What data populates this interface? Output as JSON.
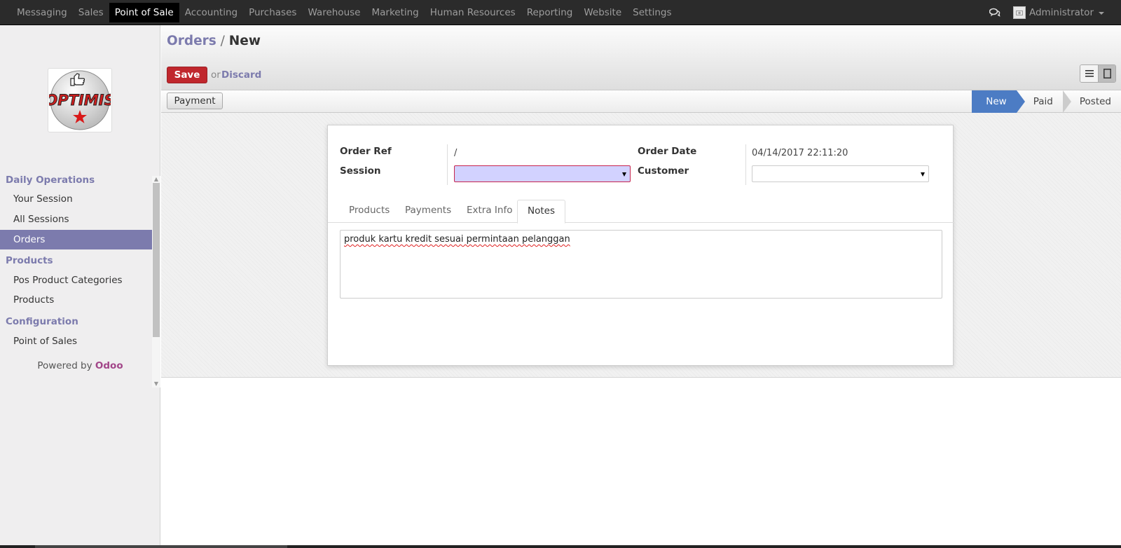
{
  "topbar": {
    "menu": [
      {
        "label": "Messaging",
        "active": false
      },
      {
        "label": "Sales",
        "active": false
      },
      {
        "label": "Point of Sale",
        "active": true
      },
      {
        "label": "Accounting",
        "active": false
      },
      {
        "label": "Purchases",
        "active": false
      },
      {
        "label": "Warehouse",
        "active": false
      },
      {
        "label": "Marketing",
        "active": false
      },
      {
        "label": "Human Resources",
        "active": false
      },
      {
        "label": "Reporting",
        "active": false
      },
      {
        "label": "Website",
        "active": false
      },
      {
        "label": "Settings",
        "active": false
      }
    ],
    "user": "Administrator",
    "chat_icon": "chat-bubbles-icon"
  },
  "sidebar": {
    "logo_text": "OPTIMIS",
    "sections": [
      {
        "title": "Daily Operations",
        "items": [
          {
            "label": "Your Session",
            "active": false
          },
          {
            "label": "All Sessions",
            "active": false
          },
          {
            "label": "Orders",
            "active": true
          }
        ]
      },
      {
        "title": "Products",
        "items": [
          {
            "label": "Pos Product Categories",
            "active": false
          },
          {
            "label": "Products",
            "active": false
          }
        ]
      },
      {
        "title": "Configuration",
        "items": [
          {
            "label": "Point of Sales",
            "active": false
          }
        ]
      }
    ],
    "powered_by": "Powered by",
    "brand": "Odoo"
  },
  "control_panel": {
    "breadcrumb_parent": "Orders",
    "breadcrumb_sep": "/",
    "breadcrumb_current": "New",
    "save_label": "Save",
    "or_label": "or",
    "discard_label": "Discard"
  },
  "statusbar": {
    "payment_label": "Payment",
    "stages": [
      {
        "label": "New",
        "current": true
      },
      {
        "label": "Paid",
        "current": false
      },
      {
        "label": "Posted",
        "current": false
      }
    ]
  },
  "form": {
    "order_ref_label": "Order Ref",
    "order_ref_value": "/",
    "session_label": "Session",
    "session_value": "",
    "order_date_label": "Order Date",
    "order_date_value": "04/14/2017 22:11:20",
    "customer_label": "Customer",
    "customer_value": "",
    "tabs": [
      {
        "label": "Products",
        "active": false
      },
      {
        "label": "Payments",
        "active": false
      },
      {
        "label": "Extra Info",
        "active": false
      },
      {
        "label": "Notes",
        "active": true
      }
    ],
    "notes": "produk kartu kredit sesuai permintaan pelanggan"
  },
  "colors": {
    "brand_purple": "#7c7bad",
    "save_red": "#c0272d",
    "stage_blue": "#4c7cc4",
    "odoo_brand": "#a24689"
  }
}
